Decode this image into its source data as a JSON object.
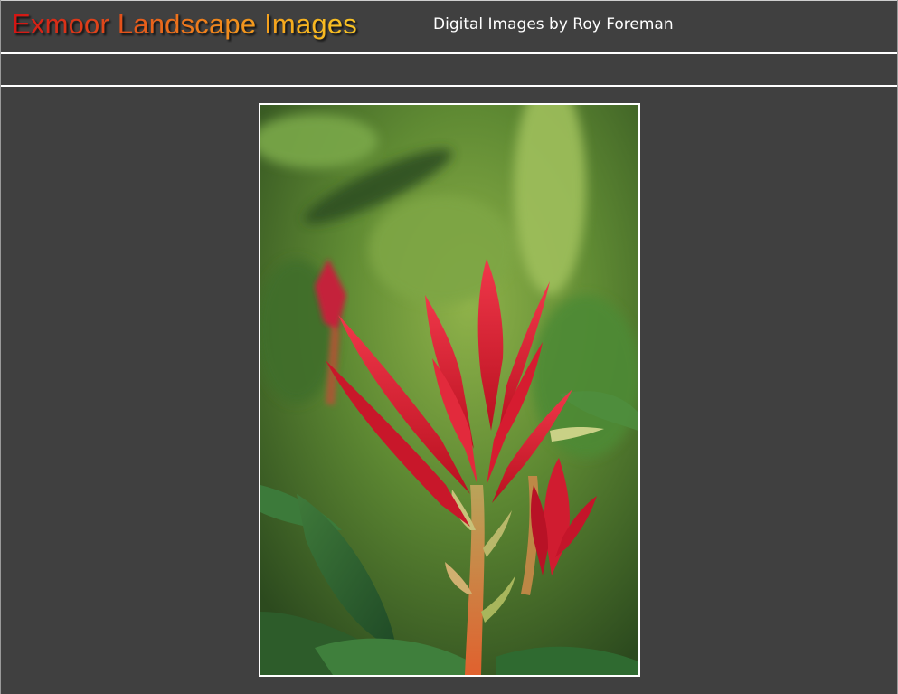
{
  "header": {
    "title": "Exmoor Landscape Images",
    "subtitle": "Digital Images by Roy Foreman"
  },
  "photo": {
    "subject": "red-flower-photo"
  },
  "colors": {
    "background": "#404040",
    "rule": "#ffffff",
    "title_gradient_start": "#d21414",
    "title_gradient_end": "#f9c425",
    "subtitle": "#ffffff"
  }
}
